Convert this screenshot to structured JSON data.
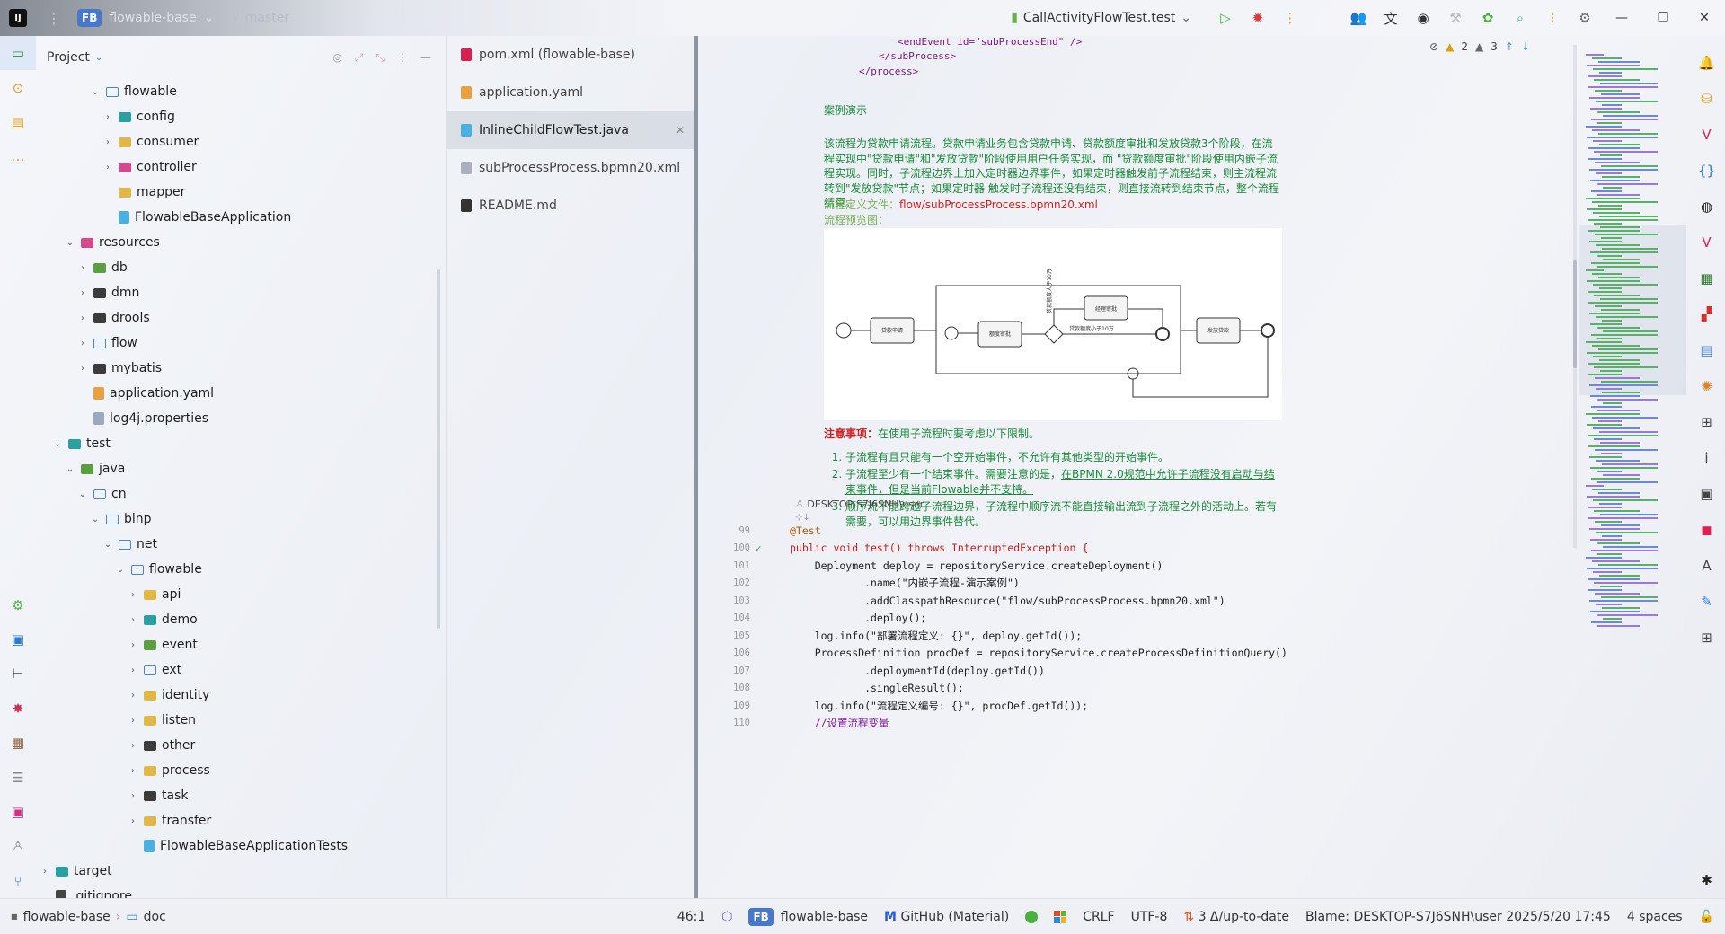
{
  "titlebar": {
    "project_badge": "FB",
    "project_name": "flowable-base",
    "branch": "master",
    "run_config": "CallActivityFlowTest.test"
  },
  "project_panel": {
    "title": "Project",
    "tree": [
      {
        "label": "flowable",
        "depth": 3,
        "chevron": "open",
        "icon": "folder-blue"
      },
      {
        "label": "config",
        "depth": 4,
        "chevron": "closed",
        "icon": "folder-teal"
      },
      {
        "label": "consumer",
        "depth": 4,
        "chevron": "closed",
        "icon": "folder"
      },
      {
        "label": "controller",
        "depth": 4,
        "chevron": "closed",
        "icon": "folder-pink"
      },
      {
        "label": "mapper",
        "depth": 4,
        "chevron": "none",
        "icon": "folder"
      },
      {
        "label": "FlowableBaseApplication",
        "depth": 4,
        "chevron": "none",
        "icon": "java-file"
      },
      {
        "label": "resources",
        "depth": 1,
        "chevron": "open",
        "icon": "folder-pink"
      },
      {
        "label": "db",
        "depth": 2,
        "chevron": "closed",
        "icon": "folder-green"
      },
      {
        "label": "dmn",
        "depth": 2,
        "chevron": "closed",
        "icon": "folder-dark"
      },
      {
        "label": "drools",
        "depth": 2,
        "chevron": "closed",
        "icon": "folder-dark"
      },
      {
        "label": "flow",
        "depth": 2,
        "chevron": "closed",
        "icon": "folder-outline"
      },
      {
        "label": "mybatis",
        "depth": 2,
        "chevron": "closed",
        "icon": "folder-dark"
      },
      {
        "label": "application.yaml",
        "depth": 2,
        "chevron": "none",
        "icon": "yaml-file"
      },
      {
        "label": "log4j.properties",
        "depth": 2,
        "chevron": "none",
        "icon": "props-file"
      },
      {
        "label": "test",
        "depth": 0,
        "chevron": "open",
        "icon": "folder-teal"
      },
      {
        "label": "java",
        "depth": 1,
        "chevron": "open",
        "icon": "folder-green"
      },
      {
        "label": "cn",
        "depth": 2,
        "chevron": "open",
        "icon": "folder-blue"
      },
      {
        "label": "blnp",
        "depth": 3,
        "chevron": "open",
        "icon": "folder-blue"
      },
      {
        "label": "net",
        "depth": 4,
        "chevron": "open",
        "icon": "folder-blue"
      },
      {
        "label": "flowable",
        "depth": 5,
        "chevron": "open",
        "icon": "folder-blue"
      },
      {
        "label": "api",
        "depth": 6,
        "chevron": "closed",
        "icon": "folder"
      },
      {
        "label": "demo",
        "depth": 6,
        "chevron": "closed",
        "icon": "folder-teal"
      },
      {
        "label": "event",
        "depth": 6,
        "chevron": "closed",
        "icon": "folder-green"
      },
      {
        "label": "ext",
        "depth": 6,
        "chevron": "closed",
        "icon": "folder-blue"
      },
      {
        "label": "identity",
        "depth": 6,
        "chevron": "closed",
        "icon": "folder"
      },
      {
        "label": "listen",
        "depth": 6,
        "chevron": "closed",
        "icon": "folder"
      },
      {
        "label": "other",
        "depth": 6,
        "chevron": "closed",
        "icon": "folder-dark"
      },
      {
        "label": "process",
        "depth": 6,
        "chevron": "closed",
        "icon": "folder"
      },
      {
        "label": "task",
        "depth": 6,
        "chevron": "closed",
        "icon": "folder-dark"
      },
      {
        "label": "transfer",
        "depth": 6,
        "chevron": "closed",
        "icon": "folder"
      },
      {
        "label": "FlowableBaseApplicationTests",
        "depth": 6,
        "chevron": "none",
        "icon": "java-file"
      },
      {
        "label": "target",
        "depth": -1,
        "chevron": "closed",
        "icon": "folder-teal"
      },
      {
        "label": ".gitignore",
        "depth": -1,
        "chevron": "none",
        "icon": "git-file"
      }
    ]
  },
  "recent_files": [
    {
      "label": "pom.xml (flowable-base)",
      "icon": "maven-icon",
      "active": false
    },
    {
      "label": "application.yaml",
      "icon": "yaml-icon",
      "active": false
    },
    {
      "label": "InlineChildFlowTest.java",
      "icon": "java-icon",
      "active": true
    },
    {
      "label": "subProcessProcess.bpmn20.xml",
      "icon": "xml-icon",
      "active": false
    },
    {
      "label": "README.md",
      "icon": "markdown-icon",
      "active": false
    }
  ],
  "editor": {
    "inspections": {
      "warnings": "2",
      "weak_warnings": "3"
    },
    "xml_lines": [
      "<endEvent id=\"subProcessEnd\" />",
      "</subProcess>",
      "</process>"
    ],
    "doc": {
      "heading": "案例演示",
      "paragraph": "该流程为贷款申请流程。贷款申请业务包含贷款申请、贷款额度审批和发放贷款3个阶段，在流程实现中\"贷款申请\"和\"发放贷款\"阶段使用用户任务实现，而 \"贷款额度审批\"阶段使用内嵌子流程实现。同时，子流程边界上加入定时器边界事件，如果定时器触发前子流程结束，则主流程流转到\"发放贷款\"节点；如果定时器 触发时子流程还没有结束，则直接流转到结束节点，整个流程结束。",
      "file_label": "流程定义文件：",
      "file_value": "flow/subProcessProcess.bpmn20.xml",
      "preview_label": "流程预览图：",
      "note_label": "注意事项：",
      "note_text": "在使用子流程时要考虑以下限制。",
      "rules": [
        {
          "text": "子流程有且只能有一个空开始事件，不允许有其他类型的开始事件。",
          "underlined": ""
        },
        {
          "text": "子流程至少有一个结束事件。需要注意的是，",
          "underlined": "在BPMN 2.0规范中允许子流程没有启动与结束事件，但是当前Flowable并不支持。"
        },
        {
          "text": "顺序流不能跨越子流程边界，子流程中顺序流不能直接输出流到子流程之外的活动上。若有需要，可以用边界事件替代。",
          "underlined": ""
        }
      ]
    },
    "diagram": {
      "task_apply": "贷款申请",
      "task_approve": "额度审批",
      "task_manager": "经理审批",
      "task_grant": "发放贷款",
      "cond_over": "贷款额度大于10万",
      "cond_under": "贷款额度小于10万"
    },
    "author": "DESKTOP-S7J6SNH\\user",
    "code": [
      {
        "num": "99",
        "text": "@Test",
        "kind": "ann"
      },
      {
        "num": "100",
        "text": "public void test() throws InterruptedException {",
        "kind": "decl"
      },
      {
        "num": "101",
        "text": "    Deployment deploy = repositoryService.createDeployment()",
        "kind": "plain"
      },
      {
        "num": "102",
        "text": "            .name(\"内嵌子流程-演示案例\")",
        "kind": "plain"
      },
      {
        "num": "103",
        "text": "            .addClasspathResource(\"flow/subProcessProcess.bpmn20.xml\")",
        "kind": "plain"
      },
      {
        "num": "104",
        "text": "            .deploy();",
        "kind": "plain"
      },
      {
        "num": "105",
        "text": "    log.info(\"部署流程定义: {}\", deploy.getId());",
        "kind": "plain"
      },
      {
        "num": "106",
        "text": "    ProcessDefinition procDef = repositoryService.createProcessDefinitionQuery()",
        "kind": "plain"
      },
      {
        "num": "107",
        "text": "            .deploymentId(deploy.getId())",
        "kind": "plain"
      },
      {
        "num": "108",
        "text": "            .singleResult();",
        "kind": "plain"
      },
      {
        "num": "109",
        "text": "    log.info(\"流程定义编号: {}\", procDef.getId());",
        "kind": "plain"
      },
      {
        "num": "110",
        "text": "    //设置流程变量",
        "kind": "comment"
      }
    ]
  },
  "statusbar": {
    "crumb_project": "flowable-base",
    "crumb_folder": "doc",
    "position": "46:1",
    "module": "flowable-base",
    "theme": "GitHub (Material)",
    "line_sep": "CRLF",
    "encoding": "UTF-8",
    "vcs": "3 Δ/up-to-date",
    "blame": "Blame: DESKTOP-S7J6SNH\\user 2025/5/20 17:45",
    "indent": "4 spaces"
  },
  "colors": {
    "accent": "#4a78c8",
    "doc_green": "#1a8a3a",
    "doc_red": "#d02020"
  }
}
